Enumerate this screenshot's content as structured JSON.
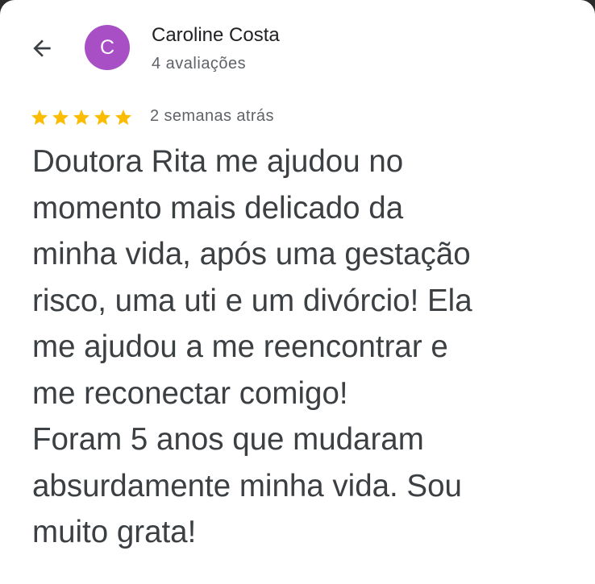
{
  "header": {
    "back_icon": "arrow-left-icon",
    "avatar_letter": "C",
    "avatar_color": "#a84fc6",
    "user_name": "Caroline Costa",
    "review_count": "4 avaliações"
  },
  "review": {
    "rating": 5,
    "max_rating": 5,
    "star_color": "#fbbc04",
    "date": "2 semanas atrás",
    "lines": [
      "Doutora Rita me ajudou no",
      "momento mais delicado da",
      "minha vida, após uma gestação",
      "risco, uma uti e um divórcio! Ela",
      "me ajudou a me reencontrar e",
      "me reconectar comigo!",
      "Foram 5 anos que mudaram",
      "absurdamente minha vida. Sou",
      "muito grata!"
    ]
  }
}
